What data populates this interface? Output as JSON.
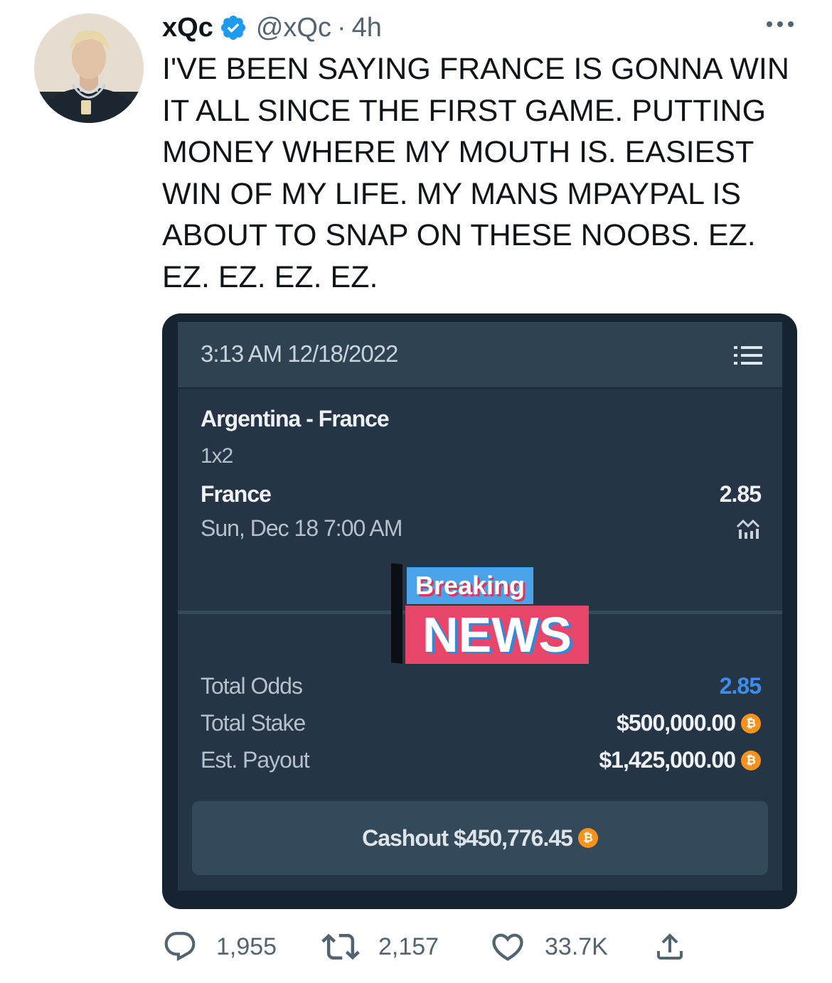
{
  "tweet": {
    "display_name": "xQc",
    "handle": "@xQc",
    "separator": "·",
    "time": "4h",
    "verified": true,
    "text": "I'VE BEEN SAYING FRANCE IS GONNA WIN\nIT ALL SINCE THE FIRST GAME. PUTTING\nMONEY WHERE MY MOUTH IS. EASIEST\nWIN OF MY LIFE. MY MANS MPAYPAL IS\nABOUT TO SNAP ON THESE NOOBS. EZ.\nEZ. EZ. EZ. EZ."
  },
  "bet_slip": {
    "datetime": "3:13 AM 12/18/2022",
    "match": "Argentina - France",
    "market": "1x2",
    "selection": "France",
    "selection_odds": "2.85",
    "event_time": "Sun, Dec 18 7:00 AM",
    "overlay_breaking": "Breaking",
    "overlay_news": "NEWS",
    "total_odds_label": "Total Odds",
    "total_odds_value": "2.85",
    "total_stake_label": "Total Stake",
    "total_stake_value": "$500,000.00",
    "est_payout_label": "Est. Payout",
    "est_payout_value": "$1,425,000.00",
    "cashout_label": "Cashout $450,776.45",
    "coin_symbol": "₿",
    "accent_color": "#3d8ee8"
  },
  "actions": {
    "replies": "1,955",
    "retweets": "2,157",
    "likes": "33.7K"
  },
  "icons": [
    "verified-badge-icon",
    "more-icon",
    "menu-icon",
    "stats-icon",
    "bitcoin-icon",
    "reply-icon",
    "retweet-icon",
    "like-icon",
    "share-icon"
  ]
}
